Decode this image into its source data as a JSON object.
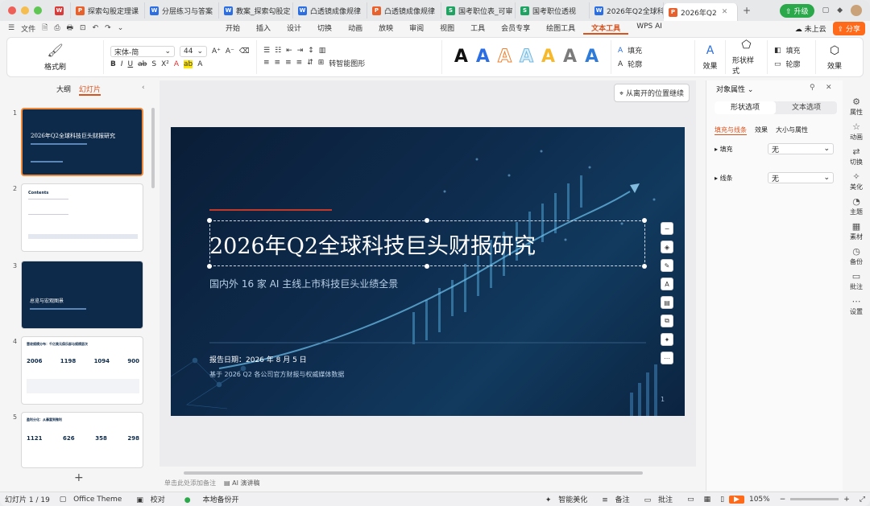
{
  "tabs": [
    {
      "type": "wps",
      "label": ""
    },
    {
      "type": "p",
      "label": "探索勾股定理课"
    },
    {
      "type": "w",
      "label": "分层练习与答案"
    },
    {
      "type": "w",
      "label": "教案_探索勾股定"
    },
    {
      "type": "w",
      "label": "凸透镜成像规律"
    },
    {
      "type": "p",
      "label": "凸透镜成像规律"
    },
    {
      "type": "s",
      "label": "国考职位表_可审"
    },
    {
      "type": "s",
      "label": "国考职位透视"
    },
    {
      "type": "w",
      "label": "2026年Q2全球科"
    },
    {
      "type": "p",
      "label": "2026年Q2"
    }
  ],
  "topbar": {
    "upgrade": "升级"
  },
  "menu": {
    "file": "文件",
    "tabs": [
      "开始",
      "插入",
      "设计",
      "切换",
      "动画",
      "放映",
      "审阅",
      "视图",
      "工具",
      "会员专享",
      "绘图工具",
      "文本工具",
      "WPS AI"
    ],
    "active": "文本工具",
    "cloud": "未上云",
    "share": "分享"
  },
  "ribbon": {
    "format_painter": "格式刷",
    "font": "宋体-简",
    "size": "44",
    "smart_shape": "转智能图形",
    "fill": "填充",
    "outline": "轮廓",
    "effect": "效果",
    "shape_style": "形状样式",
    "shape_fill": "填充",
    "shape_outline": "轮廓",
    "shape_effect": "效果"
  },
  "left": {
    "outline": "大纲",
    "slides": "幻灯片",
    "add": "+"
  },
  "thumbs": [
    {
      "num": "1",
      "title": "2026年Q2全球科技巨头财报研究"
    },
    {
      "num": "2",
      "title": "Contents"
    },
    {
      "num": "3",
      "title": "总览与宏观图景"
    },
    {
      "num": "4",
      "title": "营收规模分布：千亿美元俱乐部与规模层次",
      "vals": [
        "2006",
        "1198",
        "1094",
        "900"
      ]
    },
    {
      "num": "5",
      "title": "盈利分化：从暴富到微利",
      "vals": [
        "1121",
        "626",
        "358",
        "298"
      ]
    }
  ],
  "slide": {
    "title": "2026年Q2全球科技巨头财报研究",
    "subtitle": "国内外 16 家 AI 主线上市科技巨头业绩全景",
    "date": "报告日期：2026 年 8 月 5 日",
    "source": "基于 2026 Q2 各公司官方财报与权威媒体数据",
    "page": "1"
  },
  "resume": "从离开的位置继续",
  "props": {
    "title": "对象属性",
    "tab_shape": "形状选项",
    "tab_text": "文本选项",
    "sub": [
      "填充与线条",
      "效果",
      "大小与属性"
    ],
    "fill_label": "填充",
    "fill_val": "无",
    "line_label": "线条",
    "line_val": "无"
  },
  "rail": [
    "属性",
    "动画",
    "切换",
    "美化",
    "主题",
    "素材",
    "备份",
    "批注",
    "设置"
  ],
  "notes": {
    "placeholder": "单击此处添加备注",
    "ai": "AI 演讲稿"
  },
  "status": {
    "slide": "幻灯片 1 / 19",
    "theme": "Office Theme",
    "proof": "校对",
    "backup": "本地备份开",
    "beautify": "智能美化",
    "notes": "备注",
    "comment": "批注",
    "zoom": "105%"
  }
}
